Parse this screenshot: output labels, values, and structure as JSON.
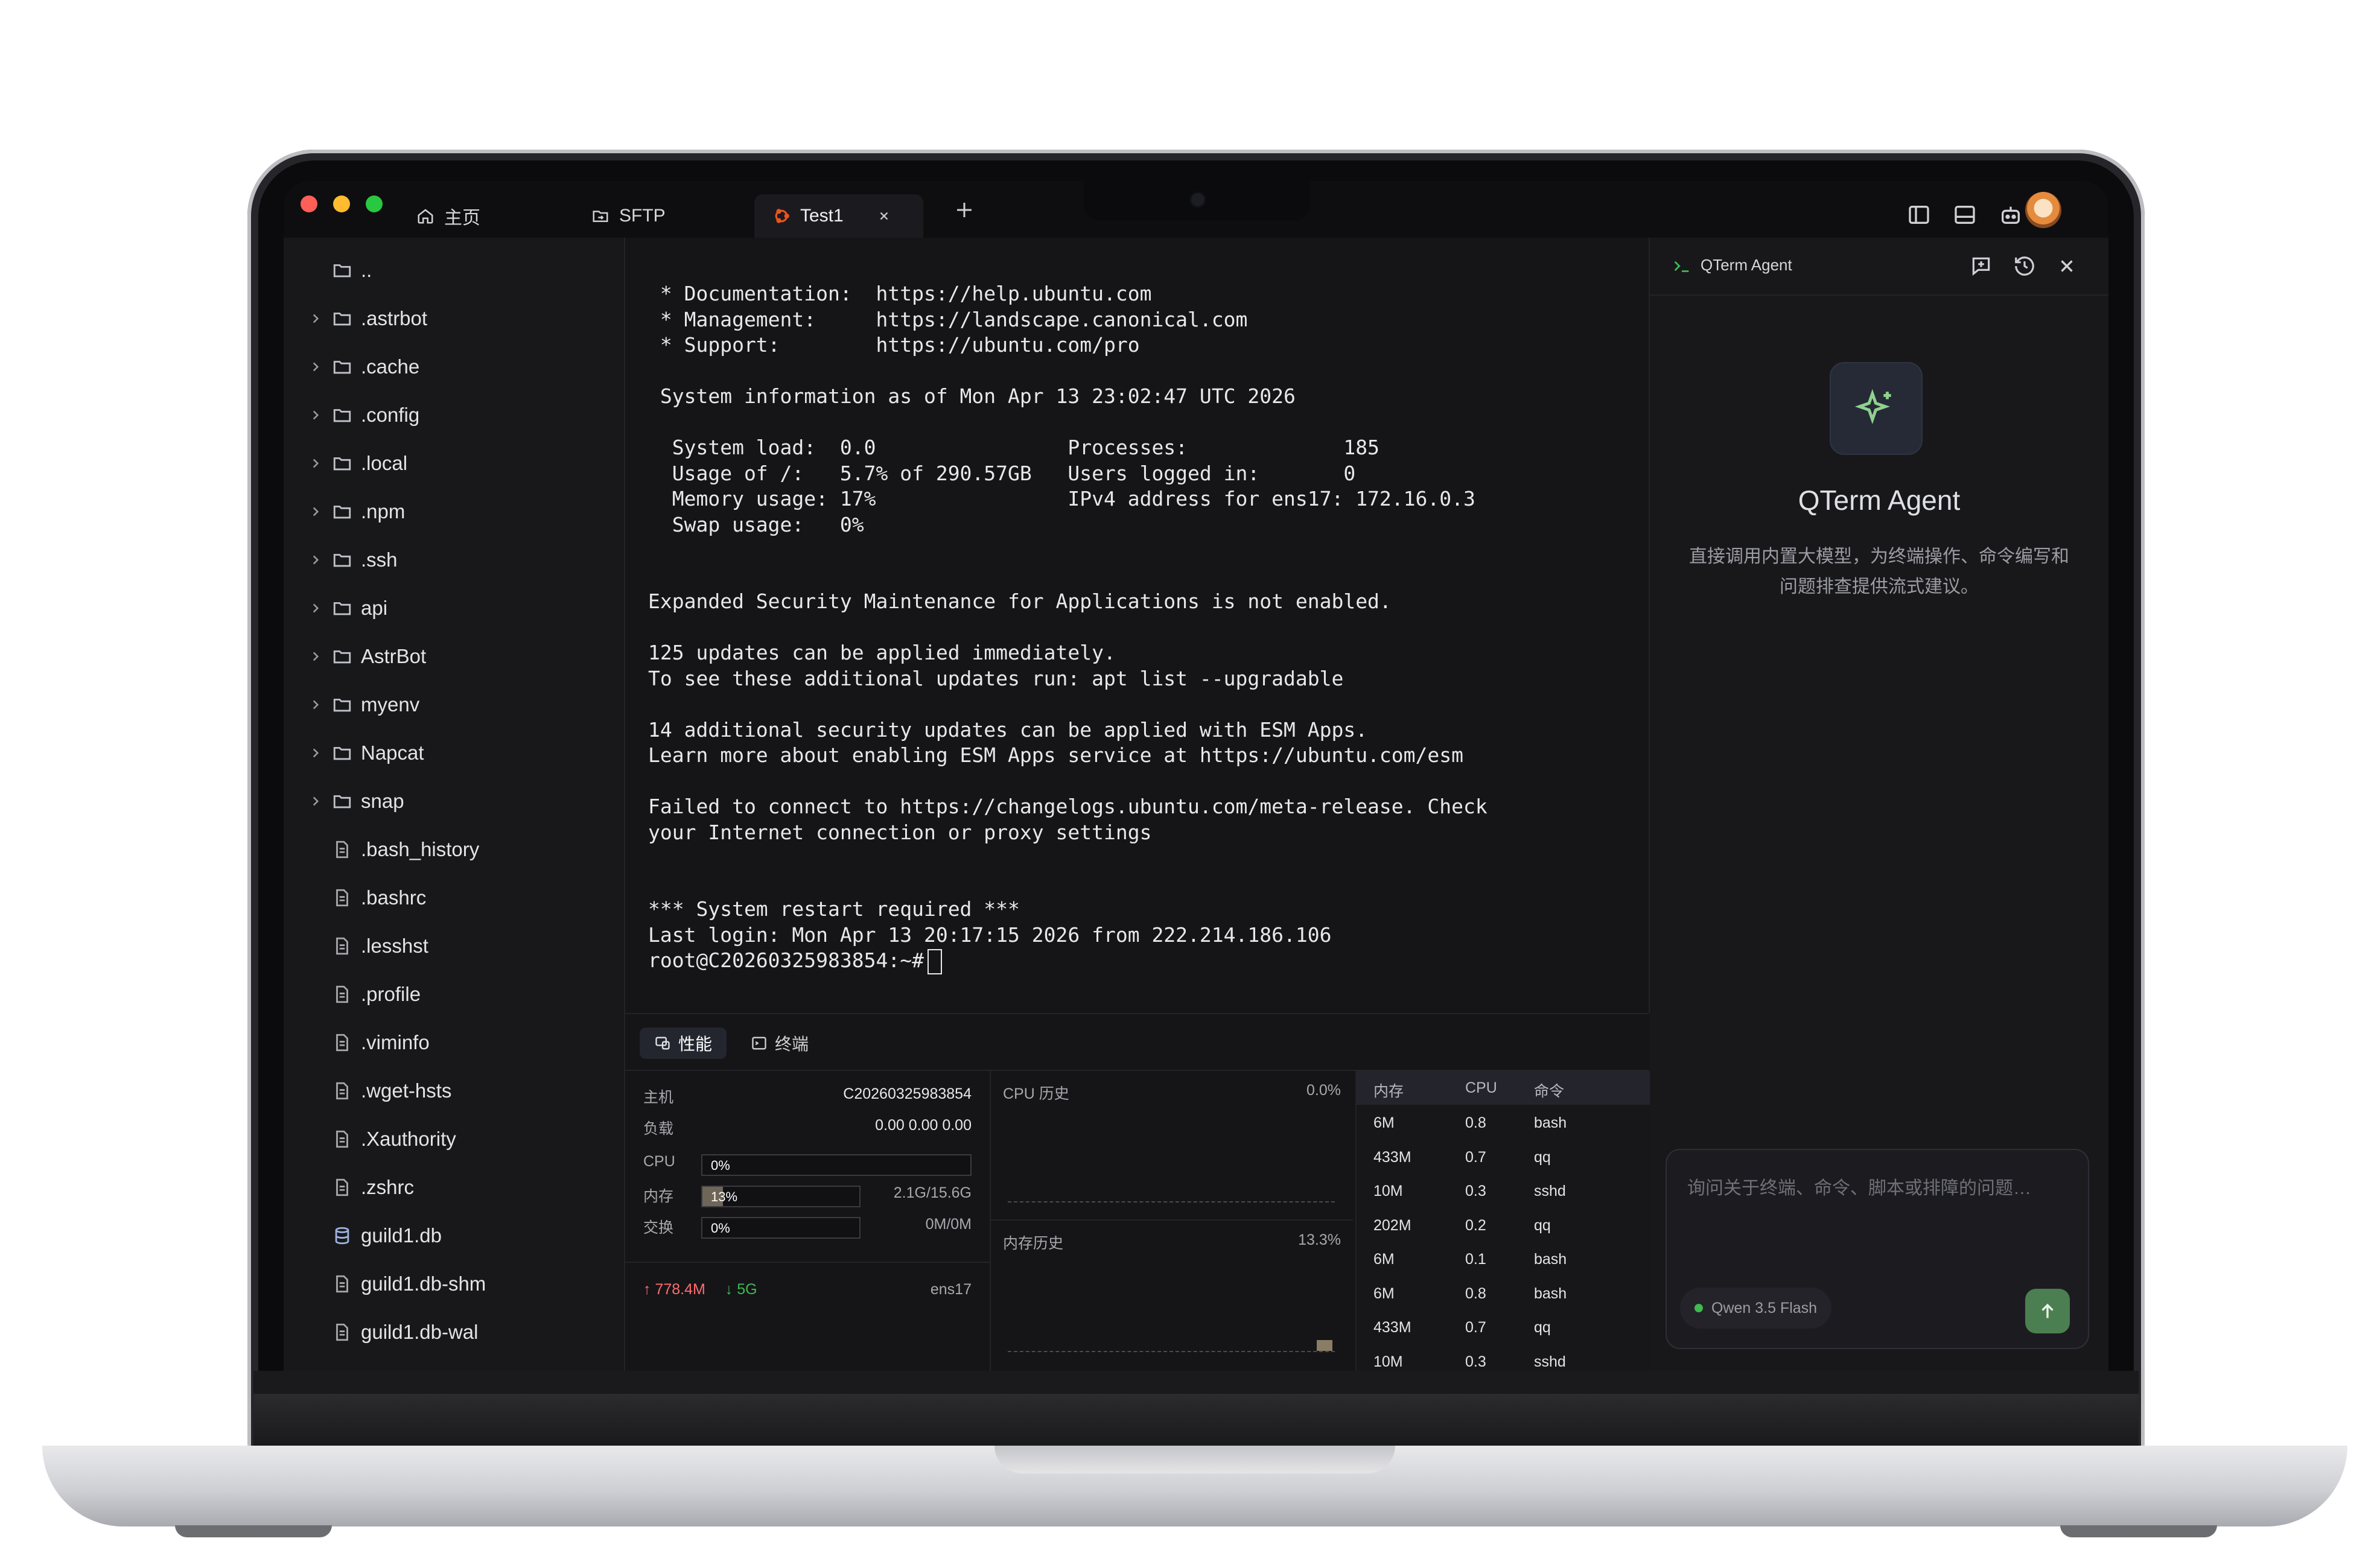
{
  "tabs": [
    {
      "label": "主页",
      "icon": "home-icon"
    },
    {
      "label": "SFTP",
      "icon": "sftp-icon"
    },
    {
      "label": "Test1",
      "icon": "ubuntu-icon",
      "active": true
    }
  ],
  "sidebar": {
    "parent": "..",
    "items": [
      {
        "name": ".astrbot",
        "type": "folder"
      },
      {
        "name": ".cache",
        "type": "folder"
      },
      {
        "name": ".config",
        "type": "folder"
      },
      {
        "name": ".local",
        "type": "folder"
      },
      {
        "name": ".npm",
        "type": "folder"
      },
      {
        "name": ".ssh",
        "type": "folder"
      },
      {
        "name": "api",
        "type": "folder"
      },
      {
        "name": "AstrBot",
        "type": "folder"
      },
      {
        "name": "myenv",
        "type": "folder"
      },
      {
        "name": "Napcat",
        "type": "folder"
      },
      {
        "name": "snap",
        "type": "folder"
      },
      {
        "name": ".bash_history",
        "type": "file"
      },
      {
        "name": ".bashrc",
        "type": "file"
      },
      {
        "name": ".lesshst",
        "type": "file"
      },
      {
        "name": ".profile",
        "type": "file"
      },
      {
        "name": ".viminfo",
        "type": "file"
      },
      {
        "name": ".wget-hsts",
        "type": "file"
      },
      {
        "name": ".Xauthority",
        "type": "file"
      },
      {
        "name": ".zshrc",
        "type": "file"
      },
      {
        "name": "guild1.db",
        "type": "db"
      },
      {
        "name": "guild1.db-shm",
        "type": "file"
      },
      {
        "name": "guild1.db-wal",
        "type": "file"
      }
    ]
  },
  "terminal": {
    "lines": [
      " * Documentation:  https://help.ubuntu.com",
      " * Management:     https://landscape.canonical.com",
      " * Support:        https://ubuntu.com/pro",
      "",
      " System information as of Mon Apr 13 23:02:47 UTC 2026",
      "",
      "  System load:  0.0                Processes:             185",
      "  Usage of /:   5.7% of 290.57GB   Users logged in:       0",
      "  Memory usage: 17%                IPv4 address for ens17: 172.16.0.3",
      "  Swap usage:   0%",
      "",
      "",
      "Expanded Security Maintenance for Applications is not enabled.",
      "",
      "125 updates can be applied immediately.",
      "To see these additional updates run: apt list --upgradable",
      "",
      "14 additional security updates can be applied with ESM Apps.",
      "Learn more about enabling ESM Apps service at https://ubuntu.com/esm",
      "",
      "Failed to connect to https://changelogs.ubuntu.com/meta-release. Check",
      "your Internet connection or proxy settings",
      "",
      "",
      "*** System restart required ***",
      "Last login: Mon Apr 13 20:17:15 2026 from 222.214.186.106",
      "root@C20260325983854:~#"
    ]
  },
  "bottom_tabs": [
    "性能",
    "终端"
  ],
  "stats": {
    "host_label": "主机",
    "host_value": "C20260325983854",
    "load_label": "负载",
    "load_value": "0.00 0.00 0.00",
    "cpu_label": "CPU",
    "cpu_value": "0%",
    "cpu_fraction": 0.0,
    "mem_label": "内存",
    "mem_value": "13%",
    "mem_fraction": 0.13,
    "mem_detail": "2.1G/15.6G",
    "swap_label": "交换",
    "swap_value": "0%",
    "swap_fraction": 0.0,
    "swap_detail": "0M/0M",
    "net_up": "↑ 778.4M",
    "net_down": "↓ 5G",
    "iface": "ens17"
  },
  "history": {
    "cpu_title": "CPU 历史",
    "cpu_percent": "0.0%",
    "mem_title": "内存历史",
    "mem_percent": "13.3%"
  },
  "processes": {
    "headers": [
      "内存",
      "CPU",
      "命令"
    ],
    "rows": [
      [
        "6M",
        "0.8",
        "bash"
      ],
      [
        "433M",
        "0.7",
        "qq"
      ],
      [
        "10M",
        "0.3",
        "sshd"
      ],
      [
        "202M",
        "0.2",
        "qq"
      ],
      [
        "6M",
        "0.1",
        "bash"
      ],
      [
        "6M",
        "0.8",
        "bash"
      ],
      [
        "433M",
        "0.7",
        "qq"
      ],
      [
        "10M",
        "0.3",
        "sshd"
      ]
    ]
  },
  "agent": {
    "header": "QTerm Agent",
    "name": "QTerm Agent",
    "description": "直接调用内置大模型，为终端操作、命令编写和问题排查提供流式建议。",
    "input_placeholder": "询问关于终端、命令、脚本或排障的问题…",
    "model": "Qwen 3.5 Flash"
  },
  "colors": {
    "traffic_red": "#ff5f57",
    "traffic_yellow": "#febc2e",
    "traffic_green": "#28c840",
    "net_up": "#ff6b6b",
    "net_down": "#3fb950",
    "accent_green": "#4b7f52"
  }
}
